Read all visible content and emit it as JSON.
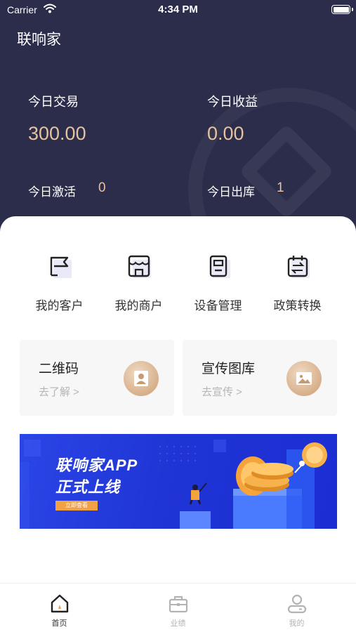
{
  "status_bar": {
    "carrier": "Carrier",
    "time": "4:34 PM"
  },
  "header": {
    "title": "联响家",
    "stats": {
      "today_trade_label": "今日交易",
      "today_trade_value": "300.00",
      "today_income_label": "今日收益",
      "today_income_value": "0.00",
      "today_activate_label": "今日激活",
      "today_activate_value": "0",
      "today_outbound_label": "今日出库",
      "today_outbound_value": "1"
    }
  },
  "quick_menu": [
    {
      "label": "我的客户",
      "icon": "flag-icon"
    },
    {
      "label": "我的商户",
      "icon": "store-icon"
    },
    {
      "label": "设备管理",
      "icon": "device-icon"
    },
    {
      "label": "政策转换",
      "icon": "calendar-swap-icon"
    }
  ],
  "features": [
    {
      "title": "二维码",
      "subtitle": "去了解 >",
      "icon": "user-icon"
    },
    {
      "title": "宣传图库",
      "subtitle": "去宣传 >",
      "icon": "image-icon"
    }
  ],
  "banner": {
    "line1": "联响家APP",
    "line2": "正式上线",
    "button": "立即查看"
  },
  "tabbar": [
    {
      "label": "首页",
      "icon": "home-icon",
      "active": true
    },
    {
      "label": "业绩",
      "icon": "briefcase-icon",
      "active": false
    },
    {
      "label": "我的",
      "icon": "profile-icon",
      "active": false
    }
  ],
  "colors": {
    "header_bg": "#2b2d4b",
    "accent_gold": "#e7c29f",
    "banner_blue": "#2035d6",
    "tab_active": "#333333",
    "tab_inactive": "#b3b3b3"
  }
}
